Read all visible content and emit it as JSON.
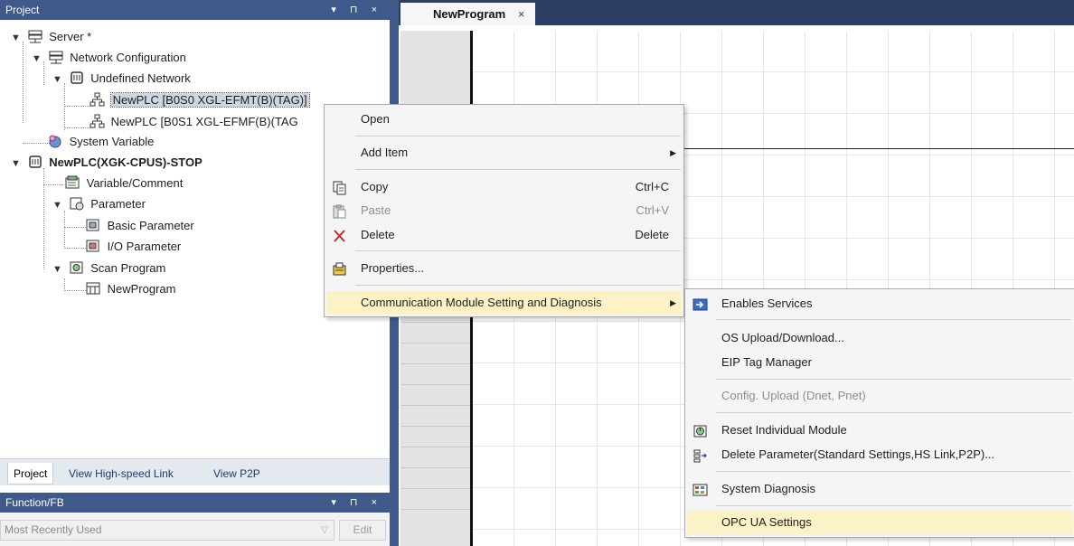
{
  "project_panel": {
    "title": "Project",
    "controls": "▾ ⊓ ×",
    "tree": [
      {
        "label": "Server *"
      },
      {
        "label": "Network Configuration"
      },
      {
        "label": "Undefined Network"
      },
      {
        "label": "NewPLC [B0S0 XGL-EFMT(B)(TAG)]"
      },
      {
        "label": "NewPLC [B0S1 XGL-EFMF(B)(TAG"
      },
      {
        "label": "System Variable"
      },
      {
        "label": "NewPLC(XGK-CPUS)-STOP"
      },
      {
        "label": "Variable/Comment"
      },
      {
        "label": "Parameter"
      },
      {
        "label": "Basic Parameter"
      },
      {
        "label": "I/O Parameter"
      },
      {
        "label": "Scan Program"
      },
      {
        "label": "NewProgram"
      }
    ],
    "bottom_tabs": [
      "Project",
      "View High-speed Link",
      "View P2P"
    ]
  },
  "function_panel": {
    "title": "Function/FB",
    "controls": "▾ ⊓ ×",
    "select_value": "Most Recently Used",
    "edit_label": "Edit"
  },
  "editor": {
    "tab_label": "NewProgram",
    "tab_close": "×"
  },
  "context_menu": {
    "open": "Open",
    "add_item": "Add Item",
    "copy": "Copy",
    "copy_shortcut": "Ctrl+C",
    "paste": "Paste",
    "paste_shortcut": "Ctrl+V",
    "delete": "Delete",
    "delete_shortcut": "Delete",
    "properties": "Properties...",
    "comm_module": "Communication Module Setting and Diagnosis"
  },
  "submenu": {
    "enables_services": "Enables Services",
    "os_upload": "OS Upload/Download...",
    "eip_tag": "EIP Tag Manager",
    "config_upload": "Config. Upload (Dnet, Pnet)",
    "reset_module": "Reset Individual Module",
    "delete_param": "Delete Parameter(Standard Settings,HS Link,P2P)...",
    "system_diag": "System Diagnosis",
    "opc_ua": "OPC UA Settings"
  },
  "colors": {
    "panel_header": "#3f5a8a",
    "menu_highlight": "#fcf2c5",
    "selection": "#cfd6e2"
  }
}
